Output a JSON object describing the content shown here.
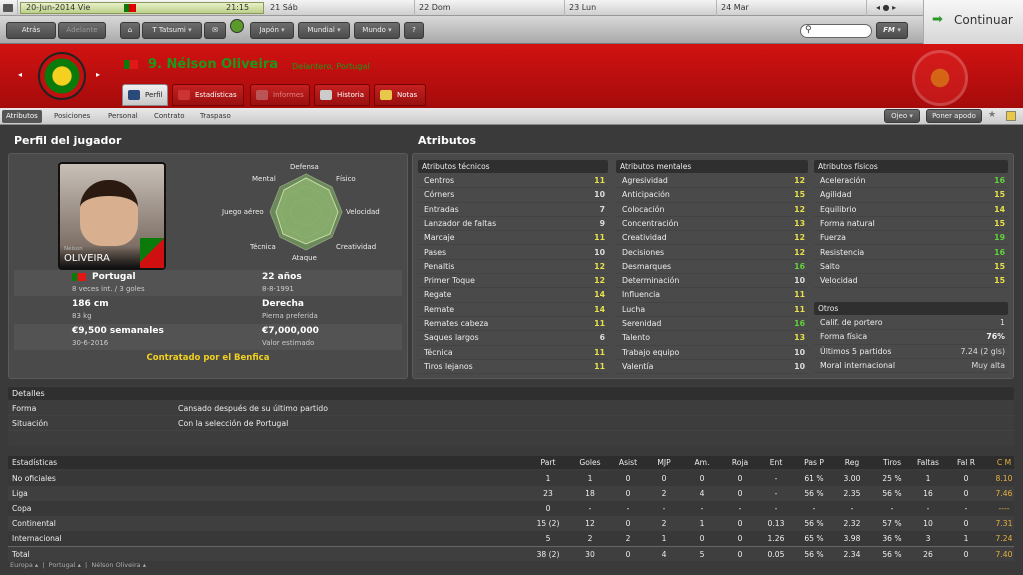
{
  "datebar": {
    "date": "20-Jun-2014 Vie",
    "time": "21:15",
    "d1": "21 Sáb",
    "d2": "22 Dom",
    "d3": "23 Lun",
    "d4": "24 Mar"
  },
  "nav": {
    "back": "Atrás",
    "forward": "Adelante",
    "manager": "T Tatsumi",
    "japon": "Japón",
    "mundial": "Mundial",
    "mundo": "Mundo",
    "fm": "FM",
    "continuar": "Continuar"
  },
  "player": {
    "number_name": "9. Nélson Oliveira",
    "role": "Delantero, Portugal",
    "card_first": "Nélson",
    "card_last": "OLIVEIRA",
    "nation": "Portugal",
    "caps": "8 veces int. / 3 goles",
    "age": "22 años",
    "dob": "8-8-1991",
    "height": "186 cm",
    "weight": "83 kg",
    "foot": "Derecha",
    "foot_label": "Pierna preferida",
    "wage": "€9,500 semanales",
    "contract": "30-6-2016",
    "value": "€7,000,000",
    "value_label": "Valor estimado",
    "contracted": "Contratado por el Benfica"
  },
  "tabs": [
    "Perfil",
    "Estadísticas",
    "Informes",
    "Historia",
    "Notas"
  ],
  "subnav": [
    "Atributos",
    "Posiciones",
    "Personal",
    "Contrato",
    "Traspaso"
  ],
  "subnav_right": {
    "ojeo": "Ojeo",
    "apodo": "Poner apodo"
  },
  "sections": {
    "perfil": "Perfil del jugador",
    "atributos": "Atributos",
    "detalles": "Detalles"
  },
  "radar": [
    "Defensa",
    "Físico",
    "Velocidad",
    "Creatividad",
    "Ataque",
    "Técnica",
    "Juego aéreo",
    "Mental"
  ],
  "tech_title": "Atributos técnicos",
  "tech": [
    [
      "Centros",
      "11",
      "y"
    ],
    [
      "Córners",
      "10",
      "w"
    ],
    [
      "Entradas",
      "7",
      "w"
    ],
    [
      "Lanzador de faltas",
      "9",
      "w"
    ],
    [
      "Marcaje",
      "11",
      "y"
    ],
    [
      "Pases",
      "10",
      "w"
    ],
    [
      "Penaltis",
      "12",
      "y"
    ],
    [
      "Primer Toque",
      "12",
      "y"
    ],
    [
      "Regate",
      "14",
      "y"
    ],
    [
      "Remate",
      "14",
      "y"
    ],
    [
      "Remates cabeza",
      "11",
      "y"
    ],
    [
      "Saques largos",
      "6",
      "w"
    ],
    [
      "Técnica",
      "11",
      "y"
    ],
    [
      "Tiros lejanos",
      "11",
      "y"
    ]
  ],
  "ment_title": "Atributos mentales",
  "ment": [
    [
      "Agresividad",
      "12",
      "y"
    ],
    [
      "Anticipación",
      "15",
      "y"
    ],
    [
      "Colocación",
      "12",
      "y"
    ],
    [
      "Concentración",
      "13",
      "y"
    ],
    [
      "Creatividad",
      "12",
      "y"
    ],
    [
      "Decisiones",
      "12",
      "y"
    ],
    [
      "Desmarques",
      "16",
      "g"
    ],
    [
      "Determinación",
      "10",
      "w"
    ],
    [
      "Influencia",
      "11",
      "y"
    ],
    [
      "Lucha",
      "11",
      "y"
    ],
    [
      "Serenidad",
      "16",
      "g"
    ],
    [
      "Talento",
      "13",
      "y"
    ],
    [
      "Trabajo equipo",
      "10",
      "w"
    ],
    [
      "Valentía",
      "10",
      "w"
    ]
  ],
  "phys_title": "Atributos físicos",
  "phys": [
    [
      "Aceleración",
      "16",
      "g"
    ],
    [
      "Agilidad",
      "15",
      "y"
    ],
    [
      "Equilibrio",
      "14",
      "y"
    ],
    [
      "Forma natural",
      "15",
      "y"
    ],
    [
      "Fuerza",
      "19",
      "g"
    ],
    [
      "Resistencia",
      "16",
      "g"
    ],
    [
      "Salto",
      "15",
      "y"
    ],
    [
      "Velocidad",
      "15",
      "y"
    ]
  ],
  "otros_title": "Otros",
  "otros": [
    [
      "Calif. de portero",
      "1"
    ],
    [
      "Forma física",
      "76%"
    ],
    [
      "Últimos 5 partidos",
      "7.24 (2 gls)"
    ],
    [
      "Moral internacional",
      "Muy alta"
    ]
  ],
  "detalles": [
    [
      "Forma",
      "Cansado después de su último partido"
    ],
    [
      "Situación",
      "Con la selección de Portugal"
    ]
  ],
  "stats_head": [
    "Estadísticas",
    "Part",
    "Goles",
    "Asist",
    "MJP",
    "Am.",
    "Roja",
    "Ent",
    "Pas P",
    "Reg",
    "Tiros",
    "Faltas",
    "Fal R",
    "C M"
  ],
  "stats": [
    [
      "No oficiales",
      "1",
      "1",
      "0",
      "0",
      "0",
      "0",
      "-",
      "61 %",
      "3.00",
      "25 %",
      "1",
      "0",
      "8.10"
    ],
    [
      "Liga",
      "23",
      "18",
      "0",
      "2",
      "4",
      "0",
      "-",
      "56 %",
      "2.35",
      "56 %",
      "16",
      "0",
      "7.46"
    ],
    [
      "Copa",
      "0",
      "-",
      "-",
      "-",
      "-",
      "-",
      "-",
      "-",
      "-",
      "-",
      "-",
      "-",
      "----"
    ],
    [
      "Continental",
      "15 (2)",
      "12",
      "0",
      "2",
      "1",
      "0",
      "0.13",
      "56 %",
      "2.32",
      "57 %",
      "10",
      "0",
      "7.31"
    ],
    [
      "Internacional",
      "5",
      "2",
      "2",
      "1",
      "0",
      "0",
      "1.26",
      "65 %",
      "3.98",
      "36 %",
      "3",
      "1",
      "7.24"
    ],
    [
      "Total",
      "38 (2)",
      "30",
      "0",
      "4",
      "5",
      "0",
      "0.05",
      "56 %",
      "2.34",
      "56 %",
      "26",
      "0",
      "7.40"
    ]
  ],
  "footer": [
    "Europa",
    "Portugal",
    "Nélson Oliveira"
  ],
  "colors": {
    "red": "#c81010",
    "yellow": "#e6e04a",
    "green": "#5fd33a"
  }
}
